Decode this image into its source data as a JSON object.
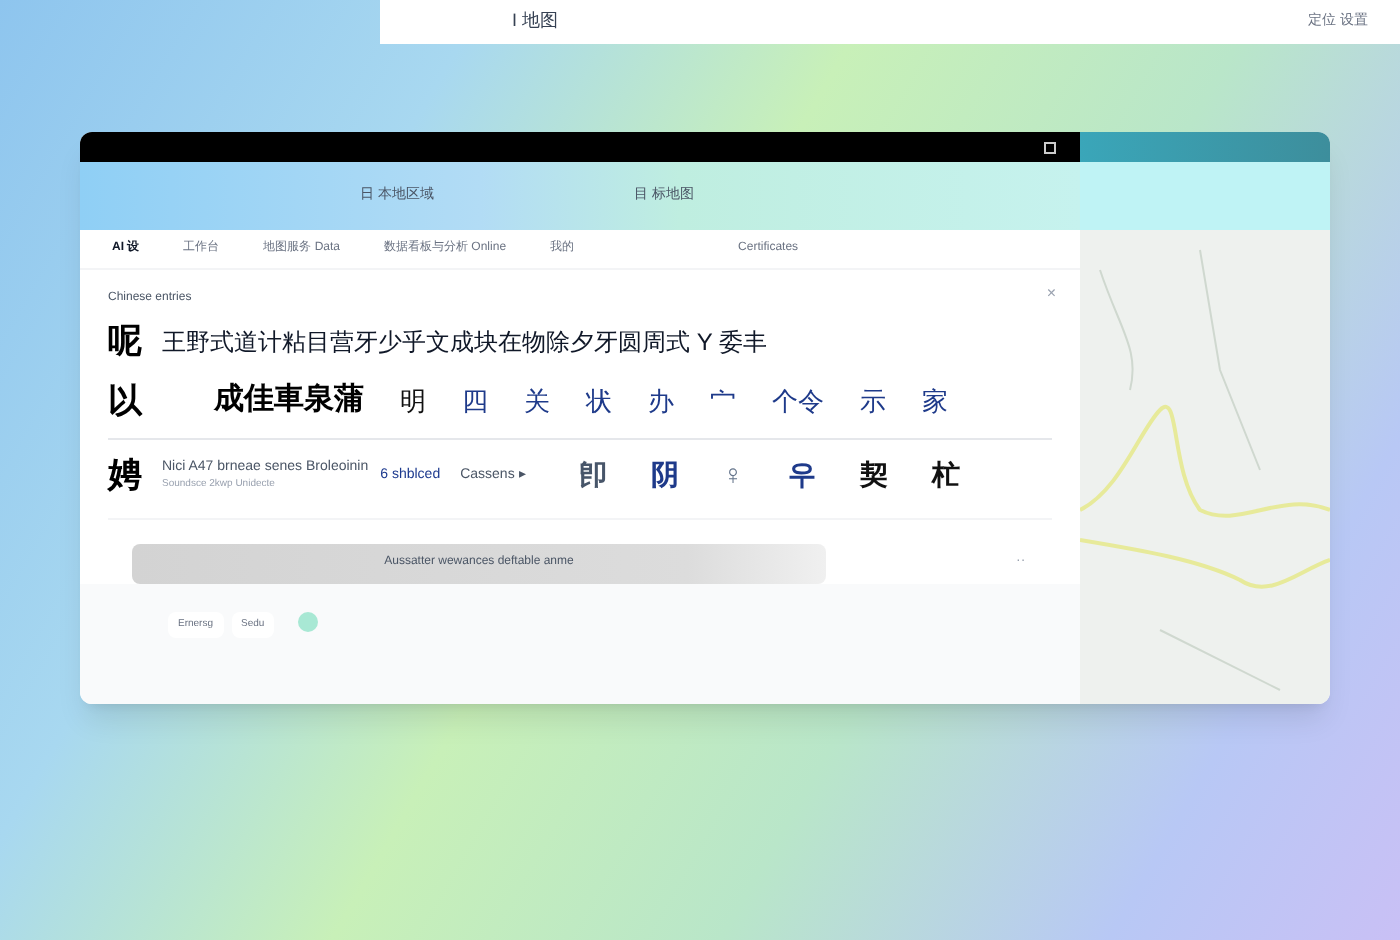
{
  "top_bar": {
    "title": "I 地图",
    "right_text": "定位 设置"
  },
  "toolbar": {
    "items": [
      "日 本地区域",
      "目 标地图"
    ]
  },
  "tabs": [
    {
      "label": "AI 设",
      "selected": true
    },
    {
      "label": "工作台",
      "selected": false
    },
    {
      "label": "地图服务 Data",
      "selected": false
    },
    {
      "label": "数据看板与分析 Online",
      "selected": false
    },
    {
      "label": "我的",
      "selected": false
    },
    {
      "label": "Certificates",
      "selected": false
    }
  ],
  "section": {
    "title": "Chinese entries",
    "close": "×"
  },
  "row_1": {
    "char": "呢",
    "text": "王野式道计粘目营牙少乎文成块在物除夕牙圆周式 Y 委丰"
  },
  "row_2": {
    "char": "以",
    "word": "成佳車泉蒲",
    "items": [
      {
        "text": "明",
        "color": "#111111"
      },
      {
        "text": "四",
        "color": "#1e3a8a"
      },
      {
        "text": "关",
        "color": "#1e3a8a"
      },
      {
        "text": "状",
        "color": "#1e3a8a"
      },
      {
        "text": "办",
        "color": "#1e3a8a"
      },
      {
        "text": "宀",
        "color": "#1e3a8a"
      },
      {
        "text": "个令",
        "color": "#1e3a8a"
      },
      {
        "text": "示",
        "color": "#1e3a8a"
      },
      {
        "text": "家",
        "color": "#1e3a8a"
      }
    ]
  },
  "row_3": {
    "char": "娉",
    "title": "Nici A47 brneae senes Broleoinin",
    "subtitle": "Soundsce 2kwp Unidecte",
    "status": "6 shblced",
    "dropdown": "Cassens ▸",
    "items": [
      {
        "text": "卽",
        "color": "#475569"
      },
      {
        "text": "阴",
        "color": "#1e3a8a"
      },
      {
        "text": "♀",
        "color": "#64748b"
      },
      {
        "text": "우",
        "color": "#1e3a8a"
      },
      {
        "text": "契",
        "color": "#111111"
      },
      {
        "text": "杧",
        "color": "#111111"
      }
    ]
  },
  "action_bar": {
    "label": "Aussatter wewances deftable anme"
  },
  "footer": {
    "pills": [
      "Ernersg",
      "Sedu"
    ],
    "more": "··"
  }
}
